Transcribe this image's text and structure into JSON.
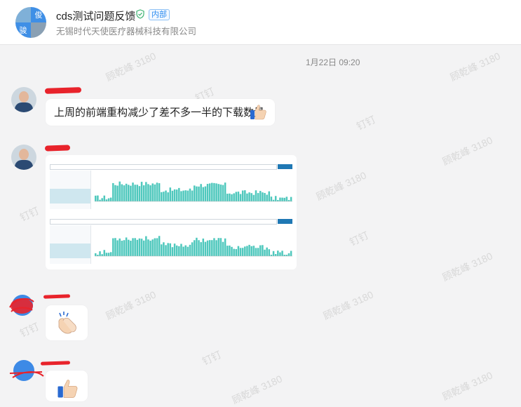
{
  "header": {
    "title": "cds测试问题反馈",
    "tag": "内部",
    "subtitle": "无锡时代天使医疗器械科技有限公司",
    "avatar_chars": [
      "俊",
      "俊",
      "骏",
      ""
    ]
  },
  "chat": {
    "timestamp": "1月22日 09:20",
    "messages": [
      {
        "type": "text",
        "text": "上周的前端重构减少了差不多一半的下载数量",
        "emoji": "thumbs-up"
      },
      {
        "type": "image"
      },
      {
        "type": "emoji",
        "emoji": "clapping-hands"
      },
      {
        "type": "emoji",
        "emoji": "thumbs-up"
      }
    ]
  },
  "watermark": {
    "text": "顾乾峰 3180",
    "alt": "钉钉"
  },
  "icons": {
    "verified": "shield-check-icon",
    "thumbs": "thumbs-up-icon",
    "clap": "clapping-hands-icon"
  },
  "colors": {
    "accent": "#2d8cf0",
    "bar": "#4fc8bd",
    "redaction": "#e8232b"
  }
}
